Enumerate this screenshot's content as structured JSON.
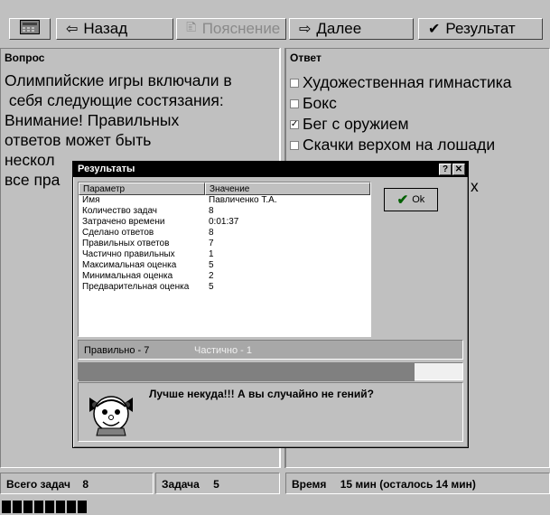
{
  "toolbar": {
    "calc_icon": "calculator-icon",
    "back_label": "Назад",
    "explain_label": "Пояснение",
    "next_label": "Далее",
    "result_label": "Результат"
  },
  "question": {
    "header": "Вопрос",
    "lines": [
      "Олимпийские игры включали в",
      " себя следующие состязания:",
      "Внимание! Правильных",
      "ответов может быть",
      "нескол",
      "все пра"
    ]
  },
  "answer": {
    "header": "Ответ",
    "items": [
      {
        "label": "Художественная гимнастика",
        "checked": false
      },
      {
        "label": "Бокс",
        "checked": false
      },
      {
        "label": "Бег с оружием",
        "checked": true
      },
      {
        "label": "Скачки верхом на лошади",
        "checked": false
      }
    ],
    "partial_text": "х"
  },
  "dialog": {
    "title": "Результаты",
    "help_label": "?",
    "close_label": "✕",
    "columns": {
      "param": "Параметр",
      "value": "Значение"
    },
    "rows": [
      {
        "param": "Имя",
        "value": "Павличенко Т.А."
      },
      {
        "param": "Количество задач",
        "value": "8"
      },
      {
        "param": "Затрачено времени",
        "value": "0:01:37"
      },
      {
        "param": "Сделано ответов",
        "value": "8"
      },
      {
        "param": "Правильных ответов",
        "value": "7"
      },
      {
        "param": "Частично правильных",
        "value": "1"
      },
      {
        "param": "Максимальная оценка",
        "value": "5"
      },
      {
        "param": "Минимальная оценка",
        "value": "2"
      },
      {
        "param": "Предварительная оценка",
        "value": "5"
      }
    ],
    "ok_label": "Ok",
    "legend_correct": "Правильно - 7",
    "legend_partial": "Частично - 1",
    "progress_fraction": 0.875,
    "message": "Лучше некуда!!! А вы случайно не гений?"
  },
  "status": {
    "total_label": "Всего задач",
    "total_value": "8",
    "task_label": "Задача",
    "task_value": "5",
    "time_label": "Время",
    "time_value": "15 мин (осталось 14 мин)"
  },
  "progress_blocks": 8,
  "colors": {
    "title_bar": "#000000",
    "face_bg": "#c0c0c0",
    "bar_fill": "#808080",
    "legend_partial": "#f0f0f0"
  }
}
